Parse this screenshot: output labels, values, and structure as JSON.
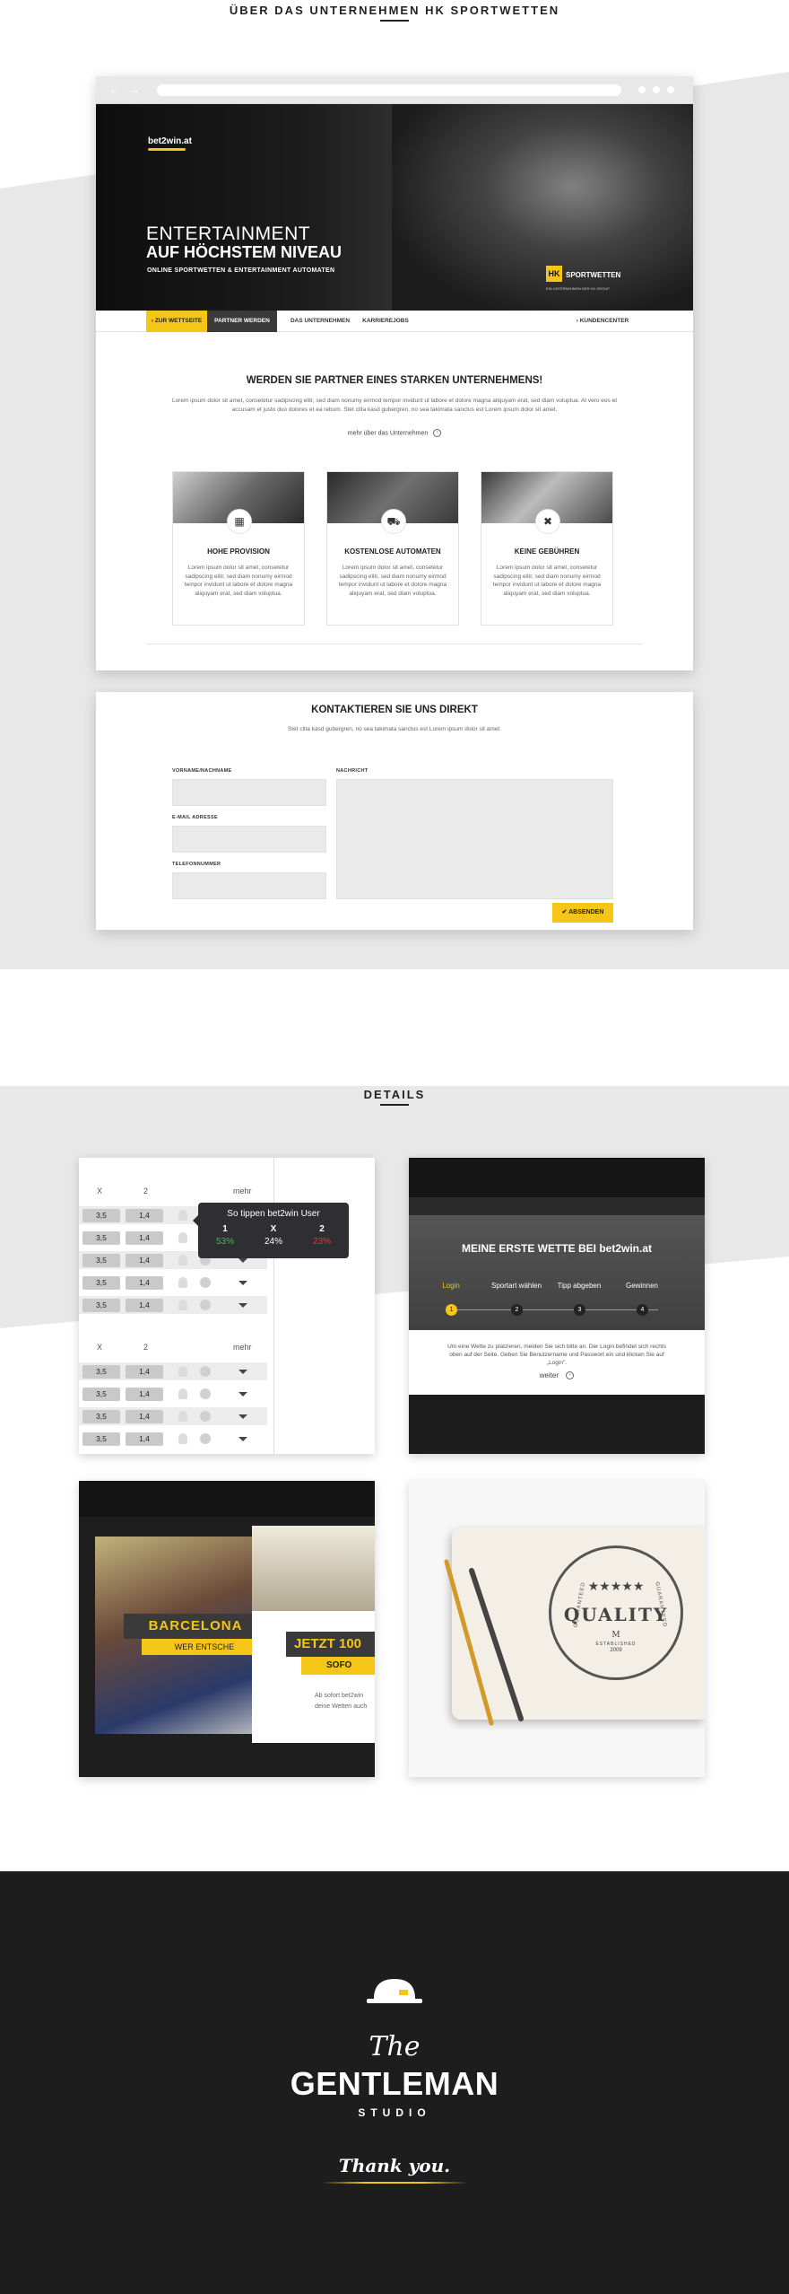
{
  "colors": {
    "accent": "#f5c518",
    "dark": "#1d1d1d",
    "panel_bg": "#e8e8e8"
  },
  "section1": {
    "title": "ÜBER DAS UNTERNEHMEN HK SPORTWETTEN"
  },
  "browser": {
    "logo": "bet2win.at",
    "hero_line1": "ENTERTAINMENT",
    "hero_line2": "AUF HÖCHSTEM NIVEAU",
    "hero_sub": "ONLINE SPORTWETTEN & ENTERTAINMENT AUTOMATEN",
    "hk_mark": "HK",
    "hk_label": "SPORTWETTEN",
    "hk_sub": "EIN UNTERNEHMEN DER HK GROUP",
    "menu": [
      "ZUR WETTSEITE",
      "PARTNER WERDEN",
      "DAS UNTERNEHMEN",
      "KARRIEREJOBS",
      "KUNDENCENTER"
    ],
    "partner_title": "WERDEN SIE PARTNER EINES STARKEN UNTERNEHMENS!",
    "partner_text": "Lorem ipsum dolor sit amet, consetetur sadipscing elitr, sed diam nonumy eirmod tempor invidunt ut labore et dolore magna aliquyam erat, sed diam voluptua. At vero eos et accusam et justo duo dolores et ea rebum. Stet clita kasd gubergren, no sea takimata sanctus est Lorem ipsum dolor sit amet.",
    "partner_more": "mehr über das Unternehmen",
    "features": [
      {
        "title": "HOHE PROVISION",
        "icon": "calculator-icon",
        "text": "Lorem ipsum dolor sit amet, consetetur sadipscing elitr, sed diam nonumy eirmod tempor invidunt ut labore et dolore magna aliquyam erat, sed diam voluptua."
      },
      {
        "title": "KOSTENLOSE AUTOMATEN",
        "icon": "truck-icon",
        "text": "Lorem ipsum dolor sit amet, consetetur sadipscing elitr, sed diam nonumy eirmod tempor invidunt ut labore et dolore magna aliquyam erat, sed diam voluptua."
      },
      {
        "title": "KEINE GEBÜHREN",
        "icon": "tools-icon",
        "text": "Lorem ipsum dolor sit amet, consetetur sadipscing elitr, sed diam nonumy eirmod tempor invidunt ut labore et dolore magna aliquyam erat, sed diam voluptua."
      }
    ]
  },
  "contact": {
    "title": "KONTAKTIEREN SIE UNS DIREKT",
    "subtitle": "Stet clita kasd gubergren, no sea takimata sanctus est Lorem ipsum dolor sit amet.",
    "label_name": "VORNAME/NACHNAME",
    "label_email": "E-MAIL ADRESSE",
    "label_phone": "TELEFONNUMMER",
    "label_message": "NACHRICHT",
    "send": "✔ ABSENDEN"
  },
  "details": {
    "title": "DETAILS",
    "odds": {
      "head_x": "X",
      "head_2": "2",
      "head_more": "mehr",
      "rows": [
        [
          "3,5",
          "1,4"
        ],
        [
          "3,5",
          "1,4"
        ],
        [
          "3,5",
          "1,4"
        ],
        [
          "3,5",
          "1,4"
        ],
        [
          "3,5",
          "1,4"
        ]
      ],
      "rows2": [
        [
          "3,5",
          "1,4"
        ],
        [
          "3,5",
          "1,4"
        ],
        [
          "3,5",
          "1,4"
        ],
        [
          "3,5",
          "1,4"
        ]
      ],
      "tooltip_title": "So tippen bet2win User",
      "tooltip_cols": [
        {
          "label": "1",
          "value": "53%",
          "color": "#3ec23e"
        },
        {
          "label": "X",
          "value": "24%",
          "color": "#ffffff"
        },
        {
          "label": "2",
          "value": "23%",
          "color": "#e03b3b"
        }
      ]
    },
    "wizard": {
      "title": "MEINE ERSTE WETTE BEI bet2win.at",
      "steps": [
        "Login",
        "Sportart wählen",
        "Tipp abgeben",
        "Gewinnen"
      ],
      "step_numbers": [
        "1",
        "2",
        "3",
        "4"
      ],
      "text": "Um eine Wette zu platzieren, melden Sie sich bitte an. Der Login befindet sich rechts oben auf der Seite. Geben Sie Benutzername und Passwort ein und klicken Sie auf „Login\".",
      "weiter": "weiter"
    },
    "promo": {
      "barca": "BARCELONA",
      "wer": "WER ENTSCHE",
      "jetzt": "JETZT 100",
      "sofo": "SOFO",
      "small1": "Ab sofort bet2win",
      "small2": "deine Wetten auch"
    },
    "stamp": {
      "quality": "QUALITY",
      "stars": "★★★★★",
      "m": "M",
      "est": "ESTABLISHED",
      "year": "2009",
      "arc_left": "GUARANTEED",
      "arc_right": "GUARANTEED"
    }
  },
  "footer": {
    "the": "The",
    "name": "GENTLEMAN",
    "studio": "STUDIO",
    "thanks": "Thank you."
  }
}
